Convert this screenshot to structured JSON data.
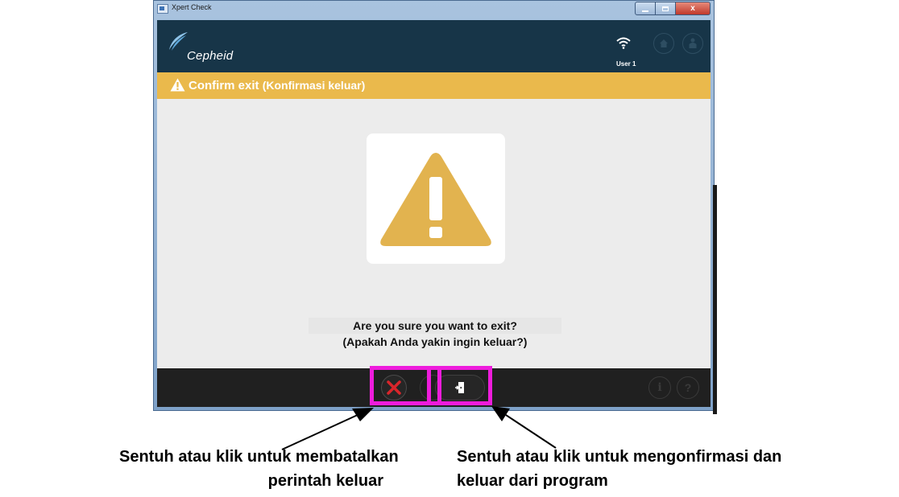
{
  "window": {
    "title": "Xpert Check",
    "controls": {
      "minimize": "minimize",
      "maximize": "maximize",
      "close": "x"
    }
  },
  "header": {
    "brand": "Cepheid",
    "user": "User 1",
    "icons": [
      "wifi-icon",
      "home-icon",
      "person-icon"
    ]
  },
  "banner": {
    "title": "Confirm exit",
    "subtitle": "(Konfirmasi keluar)",
    "icon": "warning-icon"
  },
  "dialog": {
    "icon": "warning-triangle-icon",
    "message_line1": "Are you sure you want to exit?",
    "message_line2": "(Apakah Anda yakin ingin keluar?)"
  },
  "footer": {
    "cancel_icon": "cancel-x-icon",
    "confirm_icon": "exit-door-icon",
    "info_label": "i",
    "help_label": "?"
  },
  "colors": {
    "header_bg": "#173548",
    "banner_bg": "#eab94c",
    "footer_bg": "#202020",
    "cancel_red": "#d9252b",
    "highlight": "#ee1cdc"
  },
  "annotations": {
    "left_line1": "Sentuh atau klik untuk membatalkan",
    "left_line2": "perintah keluar",
    "right_line1": "Sentuh atau klik untuk mengonfirmasi dan",
    "right_line2": "keluar dari program"
  }
}
